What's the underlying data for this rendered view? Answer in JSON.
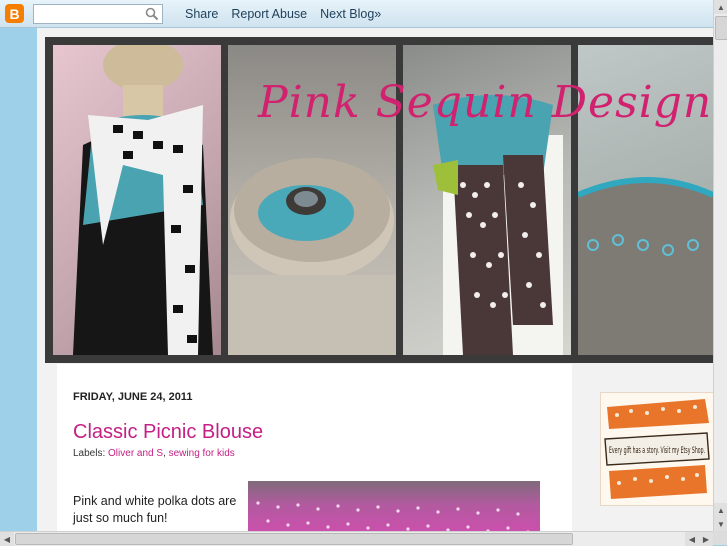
{
  "navbar": {
    "search_placeholder": "",
    "share": "Share",
    "report_abuse": "Report Abuse",
    "next_blog": "Next Blog»"
  },
  "blog": {
    "title": "Pink Sequin Designs"
  },
  "post": {
    "date": "FRIDAY, JUNE 24, 2011",
    "title": "Classic Picnic Blouse",
    "labels_prefix": "Labels:",
    "label_1": "Oliver and S",
    "label_sep": ",",
    "label_2": "sewing for kids",
    "body_line_1": "Pink and white polka dots are",
    "body_line_2": "just so much fun!"
  },
  "sidebar": {
    "badge_text": "Every gift has a story. Visit my Etsy Shop."
  },
  "colors": {
    "accent": "#c41f84",
    "title_pink": "#d0226e",
    "page_bg": "#9fd0ea"
  }
}
